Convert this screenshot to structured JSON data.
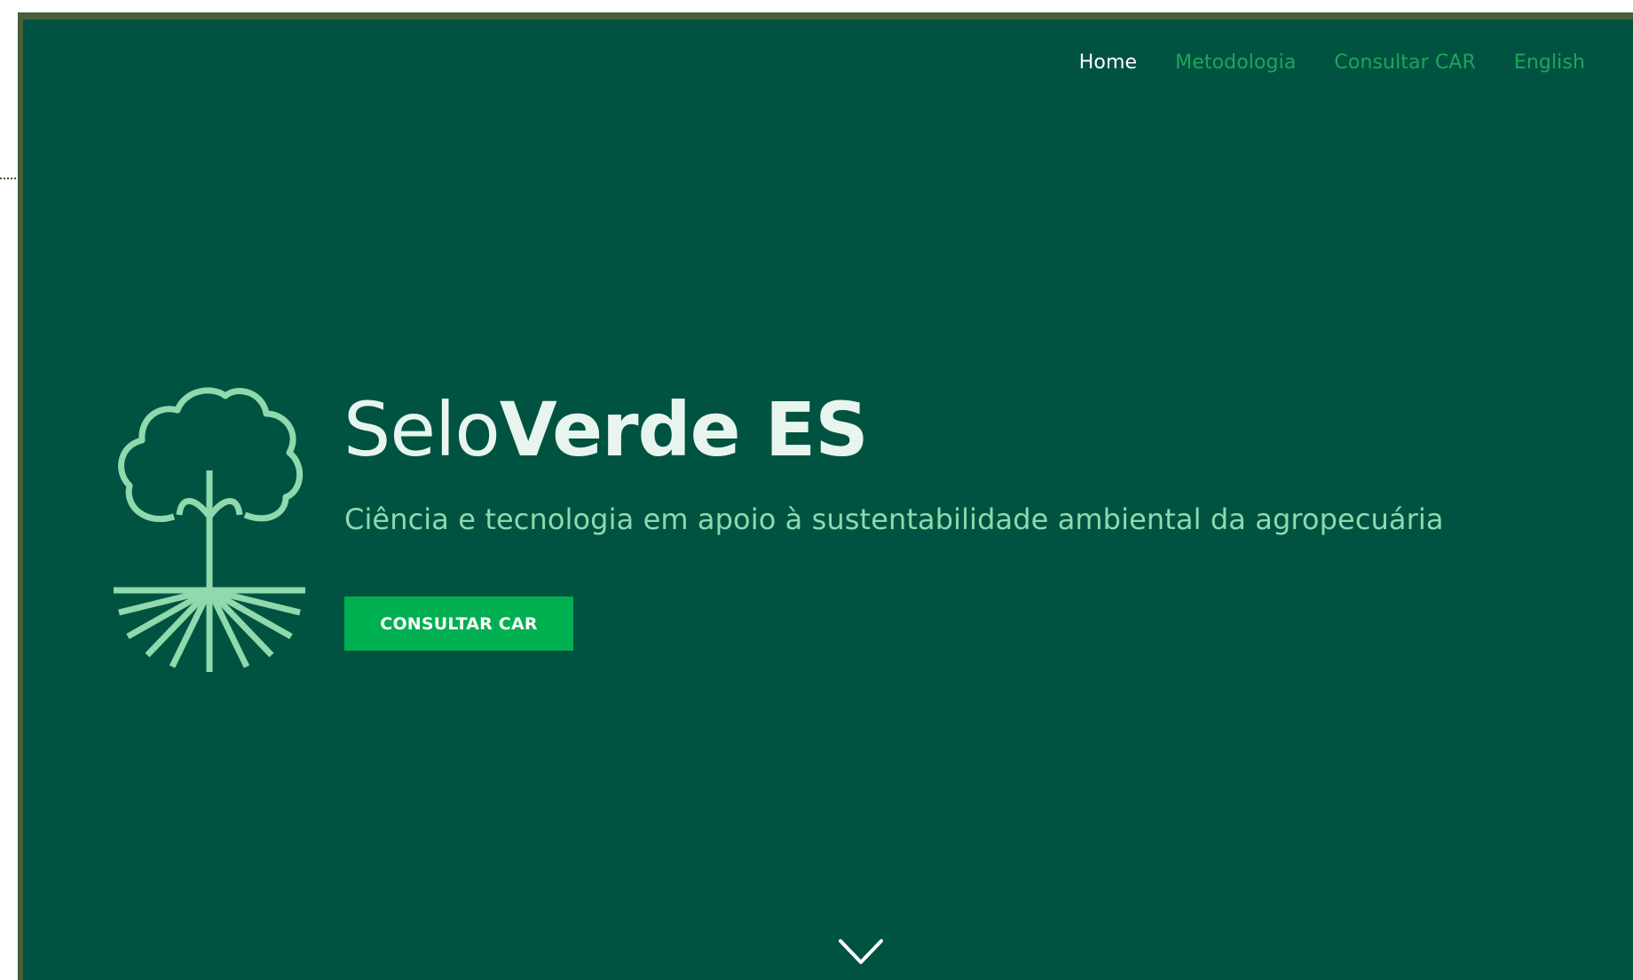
{
  "nav": {
    "items": [
      {
        "label": "Home",
        "active": true
      },
      {
        "label": "Metodologia",
        "active": false
      },
      {
        "label": "Consultar CAR",
        "active": false
      },
      {
        "label": "English",
        "active": false
      }
    ]
  },
  "hero": {
    "title_light": "Selo",
    "title_bold": "Verde ES",
    "tagline": "Ciência e tecnologia em apoio à sustentabilidade ambiental da agropecuária",
    "cta_label": "CONSULTAR CAR",
    "logo_icon": "tree-roots-icon",
    "scroll_icon": "chevron-down-icon"
  },
  "colors": {
    "background": "#005341",
    "accent": "#00b050",
    "nav_link": "#1fa55a",
    "tagline": "#8fd9ad",
    "logo": "#8fd9ad"
  }
}
